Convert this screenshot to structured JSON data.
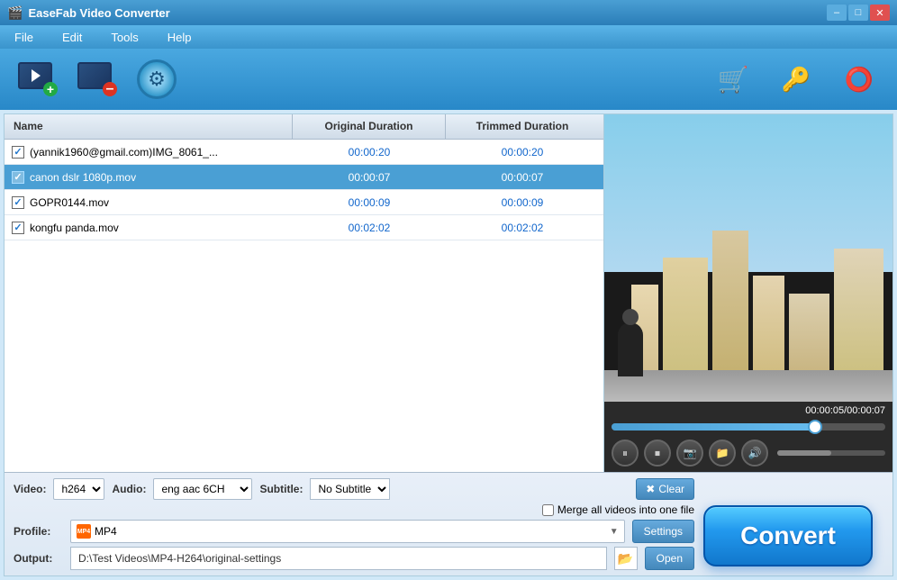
{
  "window": {
    "title": "EaseFab Video Converter",
    "controls": {
      "min": "–",
      "max": "□",
      "close": "✕"
    }
  },
  "menu": {
    "items": [
      {
        "id": "file",
        "label": "File"
      },
      {
        "id": "edit",
        "label": "Edit"
      },
      {
        "id": "tools",
        "label": "Tools"
      },
      {
        "id": "help",
        "label": "Help"
      }
    ]
  },
  "toolbar": {
    "add_video_tooltip": "Add Video",
    "remove_video_tooltip": "Remove Video",
    "settings_tooltip": "Settings",
    "cart_icon": "🛒",
    "key_icon": "🔑",
    "help_icon": "⭕"
  },
  "file_table": {
    "columns": {
      "name": "Name",
      "original_duration": "Original Duration",
      "trimmed_duration": "Trimmed Duration"
    },
    "rows": [
      {
        "checked": true,
        "name": "(yannik1960@gmail.com)IMG_8061_...",
        "original": "00:00:20",
        "trimmed": "00:00:20",
        "selected": false
      },
      {
        "checked": true,
        "name": "canon dslr 1080p.mov",
        "original": "00:00:07",
        "trimmed": "00:00:07",
        "selected": true
      },
      {
        "checked": true,
        "name": "GOPR0144.mov",
        "original": "00:00:09",
        "trimmed": "00:00:09",
        "selected": false
      },
      {
        "checked": true,
        "name": "kongfu panda.mov",
        "original": "00:02:02",
        "trimmed": "00:02:02",
        "selected": false
      }
    ]
  },
  "preview": {
    "time_display": "00:00:05/00:00:07",
    "seek_percent": 75
  },
  "format_controls": {
    "video_label": "Video:",
    "video_value": "h264",
    "audio_label": "Audio:",
    "audio_value": "eng aac 6CH",
    "subtitle_label": "Subtitle:",
    "subtitle_value": "No Subtitle",
    "clear_label": "Clear",
    "merge_label": "Merge all videos into one file"
  },
  "profile": {
    "label": "Profile:",
    "value": "MP4",
    "settings_label": "Settings"
  },
  "output": {
    "label": "Output:",
    "value": "D:\\Test Videos\\MP4-H264\\original-settings",
    "open_label": "Open"
  },
  "convert": {
    "label": "Convert"
  }
}
